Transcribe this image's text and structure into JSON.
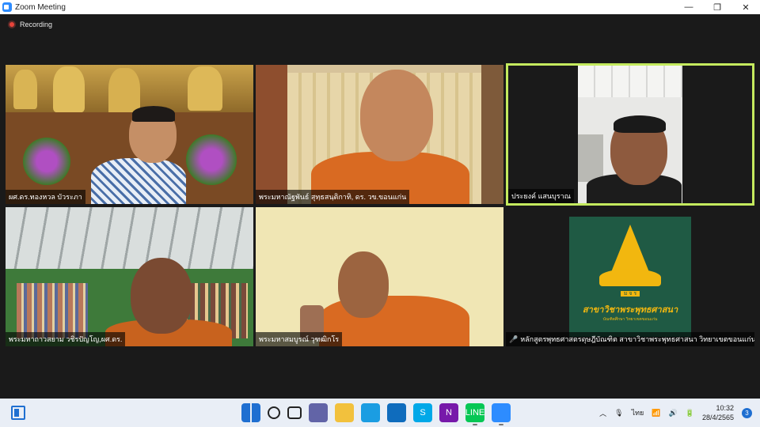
{
  "window": {
    "title": "Zoom Meeting",
    "minimize_glyph": "—",
    "maximize_glyph": "❐",
    "close_glyph": "✕"
  },
  "recording": {
    "label": "Recording"
  },
  "participants": [
    {
      "name": "ผศ.ดร.ทองหวล บัวระภา"
    },
    {
      "name": "พระมหาณัฐพันธ์ สุทฺธสนฺติกาทิ, ดร. วข.ขอนแก่น"
    },
    {
      "name": "ประยงค์ แสนบุราณ"
    },
    {
      "name": "พระมหาถาวสยาม วชิรปัญโญ,ผศ.ดร."
    },
    {
      "name": "พระมหาสมบูรณ์ วุฑฒิกโร"
    },
    {
      "name": "หลักสูตรพุทธศาสตรดุษฎีบัณฑิต สาขาวิชาพระพุทธศาสนา วิทยาเขตขอนแก่น",
      "muted": true
    }
  ],
  "emblem": {
    "abbrev": "ม จ ร",
    "title": "สาขาวิชาพระพุทธศาสนา",
    "subtitle": "บัณฑิตศึกษา วิทยาเขตขอนแก่น"
  },
  "taskbar": {
    "language": "ไทย",
    "time": "10:32",
    "date": "28/4/2565",
    "notifications": "3",
    "apps": [
      {
        "icon": "windows-start-icon",
        "color": "#1f6fd1",
        "glyph": ""
      },
      {
        "icon": "search-icon",
        "color": "#e9eef6",
        "glyph": ""
      },
      {
        "icon": "task-view-icon",
        "color": "#e9eef6",
        "glyph": ""
      },
      {
        "icon": "teams-chat-icon",
        "color": "#6264a7",
        "glyph": ""
      },
      {
        "icon": "file-explorer-icon",
        "color": "#f2c13d",
        "glyph": ""
      },
      {
        "icon": "edge-icon",
        "color": "#1b9de2",
        "glyph": ""
      },
      {
        "icon": "mail-icon",
        "color": "#0f6cbd",
        "glyph": ""
      },
      {
        "icon": "skype-icon",
        "color": "#00a8e8",
        "glyph": "S"
      },
      {
        "icon": "onenote-icon",
        "color": "#7719aa",
        "glyph": "N"
      },
      {
        "icon": "line-icon",
        "color": "#06c755",
        "glyph": "LINE"
      },
      {
        "icon": "zoom-icon",
        "color": "#2d8cff",
        "glyph": ""
      }
    ]
  },
  "colors": {
    "active_speaker_border": "#c4ea5e",
    "emblem_green": "#1f5a44",
    "emblem_gold": "#f2b70f",
    "monk_robe": "#d96a22"
  }
}
